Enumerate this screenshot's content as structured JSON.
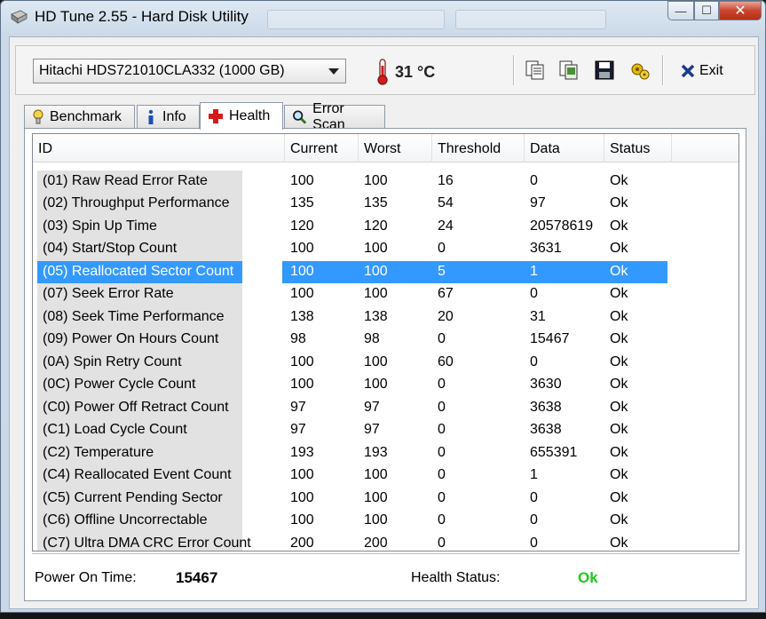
{
  "window": {
    "title": "HD Tune 2.55 - Hard Disk Utility",
    "controls": {
      "minimize": "—",
      "maximize": "☐",
      "close": "✕"
    }
  },
  "toolbar": {
    "drive": "Hitachi HDS721010CLA332 (1000 GB)",
    "temperature": "31 °C",
    "exit_label": "Exit",
    "icons": [
      "copy-text-icon",
      "copy-screenshot-icon",
      "save-icon",
      "options-icon"
    ]
  },
  "tabs": [
    {
      "label": "Benchmark",
      "icon": "benchmark-icon"
    },
    {
      "label": "Info",
      "icon": "info-icon"
    },
    {
      "label": "Health",
      "icon": "health-cross-icon",
      "active": true
    },
    {
      "label": "Error Scan",
      "icon": "magnifier-icon"
    }
  ],
  "table": {
    "headers": [
      "ID",
      "Current",
      "Worst",
      "Threshold",
      "Data",
      "Status"
    ],
    "selected_index": 4,
    "rows": [
      [
        "(01) Raw Read Error Rate",
        "100",
        "100",
        "16",
        "0",
        "Ok"
      ],
      [
        "(02) Throughput Performance",
        "135",
        "135",
        "54",
        "97",
        "Ok"
      ],
      [
        "(03) Spin Up Time",
        "120",
        "120",
        "24",
        "20578619",
        "Ok"
      ],
      [
        "(04) Start/Stop Count",
        "100",
        "100",
        "0",
        "3631",
        "Ok"
      ],
      [
        "(05) Reallocated Sector Count",
        "100",
        "100",
        "5",
        "1",
        "Ok"
      ],
      [
        "(07) Seek Error Rate",
        "100",
        "100",
        "67",
        "0",
        "Ok"
      ],
      [
        "(08) Seek Time Performance",
        "138",
        "138",
        "20",
        "31",
        "Ok"
      ],
      [
        "(09) Power On Hours Count",
        "98",
        "98",
        "0",
        "15467",
        "Ok"
      ],
      [
        "(0A) Spin Retry Count",
        "100",
        "100",
        "60",
        "0",
        "Ok"
      ],
      [
        "(0C) Power Cycle Count",
        "100",
        "100",
        "0",
        "3630",
        "Ok"
      ],
      [
        "(C0) Power Off Retract Count",
        "97",
        "97",
        "0",
        "3638",
        "Ok"
      ],
      [
        "(C1) Load Cycle Count",
        "97",
        "97",
        "0",
        "3638",
        "Ok"
      ],
      [
        "(C2) Temperature",
        "193",
        "193",
        "0",
        "655391",
        "Ok"
      ],
      [
        "(C4) Reallocated Event Count",
        "100",
        "100",
        "0",
        "1",
        "Ok"
      ],
      [
        "(C5) Current Pending Sector",
        "100",
        "100",
        "0",
        "0",
        "Ok"
      ],
      [
        "(C6) Offline Uncorrectable",
        "100",
        "100",
        "0",
        "0",
        "Ok"
      ],
      [
        "(C7) Ultra DMA CRC Error Count",
        "200",
        "200",
        "0",
        "0",
        "Ok"
      ]
    ]
  },
  "footer": {
    "power_on_label": "Power On Time:",
    "power_on_value": "15467",
    "health_label": "Health Status:",
    "health_value": "Ok"
  },
  "colors": {
    "selection": "#3399ff",
    "ok_green": "#1ec81e",
    "close_red": "#c9452d"
  }
}
